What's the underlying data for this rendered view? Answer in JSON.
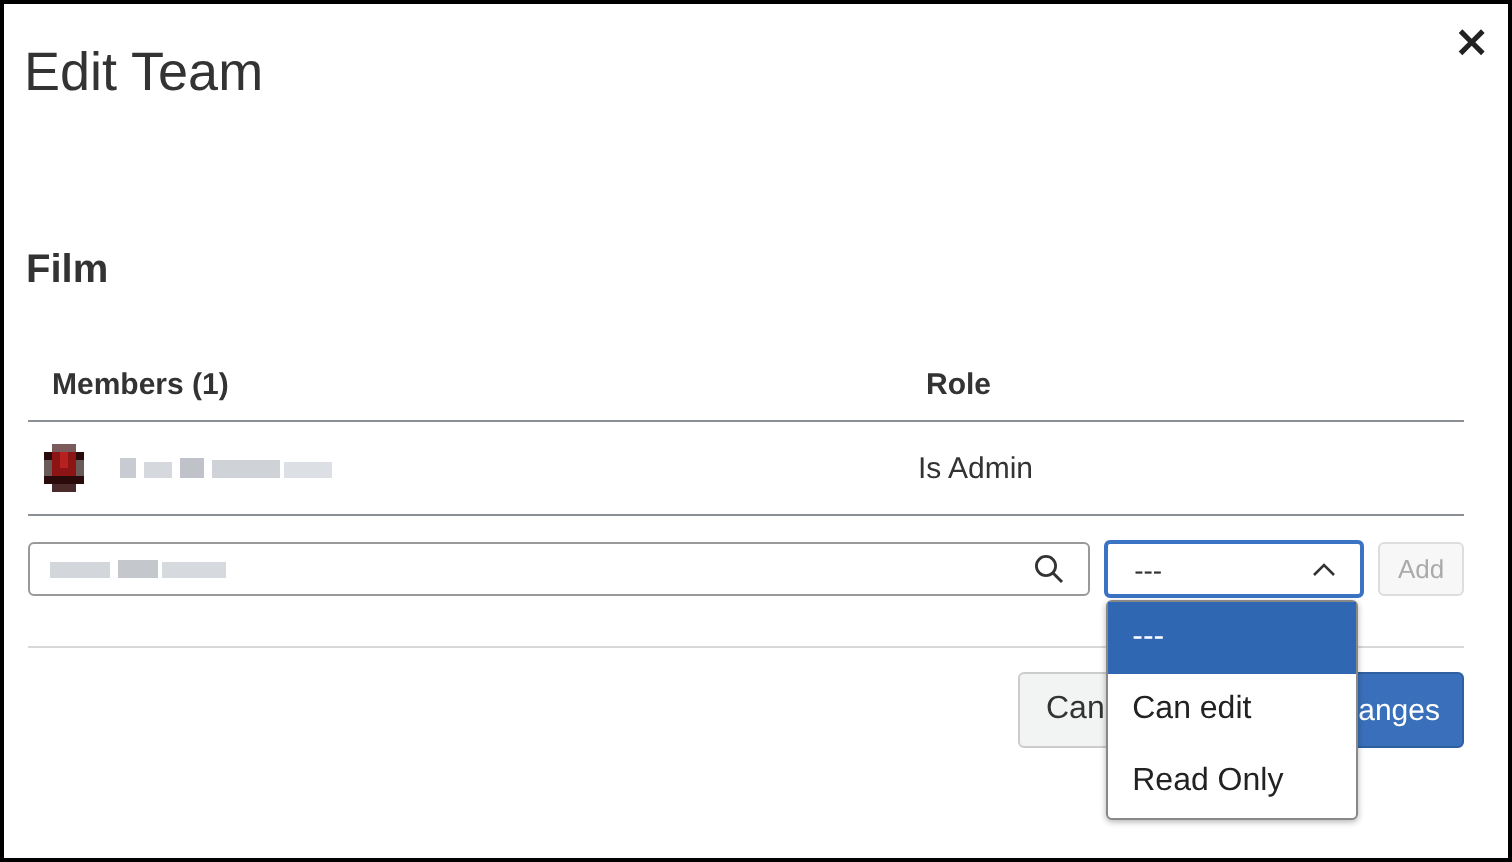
{
  "dialog": {
    "title": "Edit Team",
    "close": "×"
  },
  "team": {
    "name": "Film"
  },
  "members_table": {
    "columns": [
      "Members (1)",
      "Role"
    ],
    "rows": [
      {
        "role": "Is Admin"
      }
    ]
  },
  "add_member": {
    "role_select": {
      "value": "---",
      "expanded": true,
      "options": [
        {
          "label": "---",
          "selected": true
        },
        {
          "label": "Can edit",
          "selected": false
        },
        {
          "label": "Read Only",
          "selected": false
        }
      ]
    },
    "add_button": {
      "label": "Add",
      "disabled": true
    }
  },
  "footer": {
    "buttons": [
      {
        "label": "Can",
        "kind": "secondary"
      },
      {
        "label": "anges",
        "kind": "primary"
      }
    ]
  }
}
